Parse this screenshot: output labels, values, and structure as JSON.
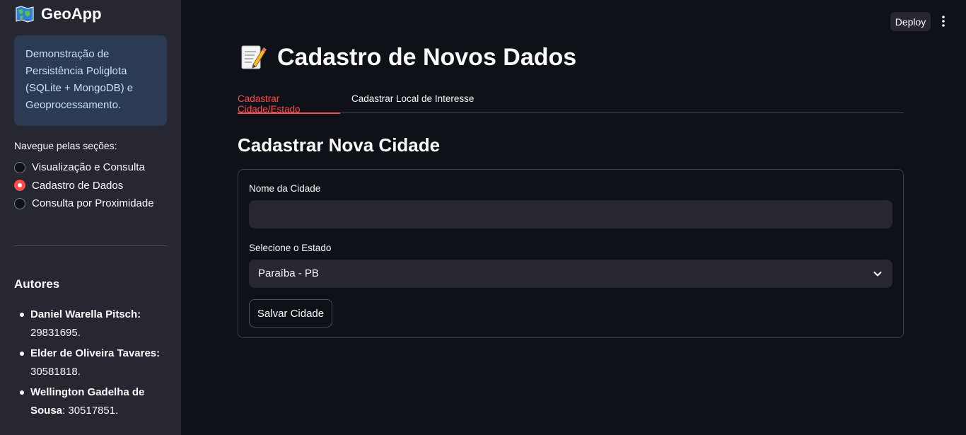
{
  "sidebar": {
    "app_title": "GeoApp",
    "info": "Demonstração de Persistência Poliglota (SQLite + MongoDB) e Geoprocessamento.",
    "nav_label": "Navegue pelas seções:",
    "nav_options": [
      {
        "label": "Visualização e Consulta",
        "selected": false
      },
      {
        "label": "Cadastro de Dados",
        "selected": true
      },
      {
        "label": "Consulta por Proximidade",
        "selected": false
      }
    ],
    "authors_title": "Autores",
    "authors": [
      {
        "name": "Daniel Warella Pitsch:",
        "id": "29831695."
      },
      {
        "name": "Elder de Oliveira Tavares:",
        "id": "30581818."
      },
      {
        "name": "Wellington Gadelha de Sousa",
        "id": ": 30517851."
      }
    ]
  },
  "header": {
    "deploy_label": "Deploy",
    "menu_icon": "vertical-dots-icon"
  },
  "main": {
    "title": "Cadastro de Novos Dados",
    "title_icon": "memo-icon",
    "tabs": [
      {
        "label": "Cadastrar Cidade/Estado",
        "active": true
      },
      {
        "label": "Cadastrar Local de Interesse",
        "active": false
      }
    ],
    "section_title": "Cadastrar Nova Cidade",
    "form": {
      "city_label": "Nome da Cidade",
      "city_value": "",
      "state_label": "Selecione o Estado",
      "state_value": "Paraíba - PB",
      "save_label": "Salvar Cidade"
    }
  },
  "colors": {
    "background": "#0e1117",
    "sidebar": "#262730",
    "accent": "#ff4b4b",
    "info_box": "#2a3b53"
  }
}
